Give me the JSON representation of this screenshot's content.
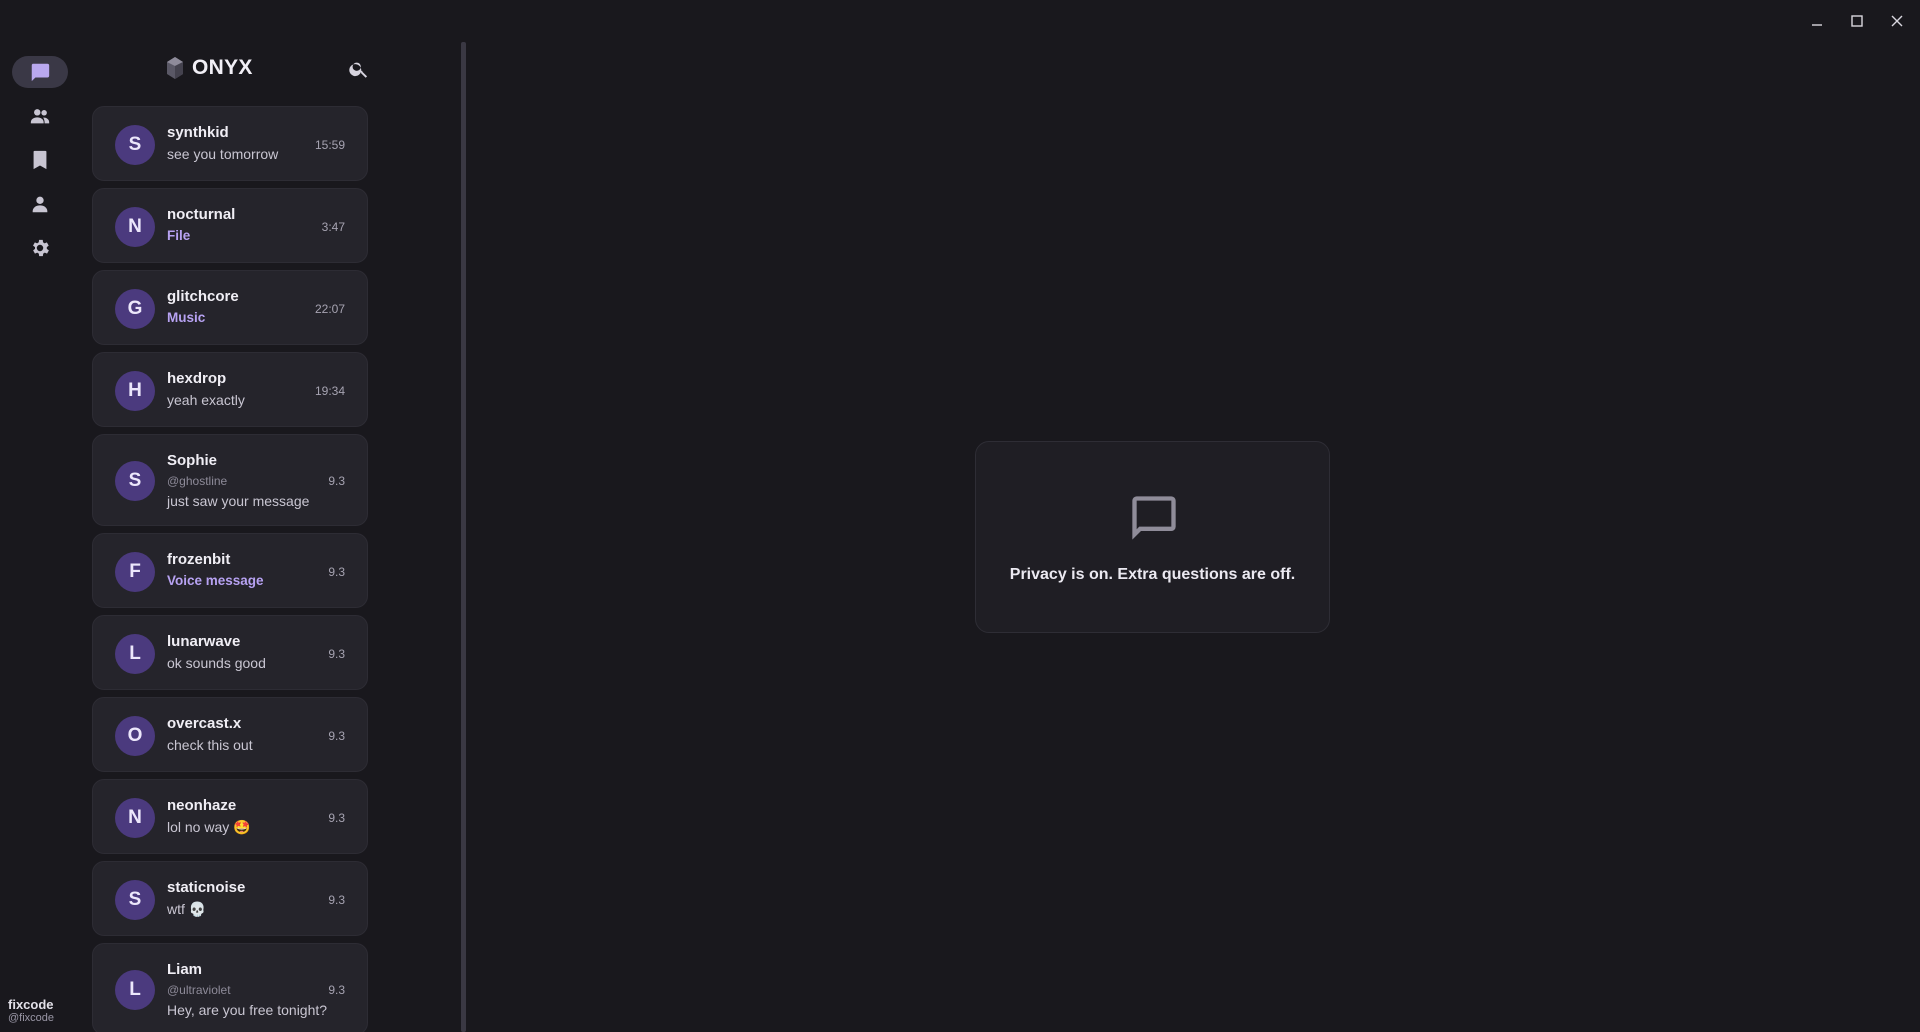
{
  "window": {
    "controls": [
      "minimize-icon",
      "maximize-icon",
      "close-icon"
    ]
  },
  "rail": {
    "items": [
      {
        "name": "chats",
        "icon": "chat-bubble-icon",
        "active": true
      },
      {
        "name": "contacts",
        "icon": "people-icon",
        "active": false
      },
      {
        "name": "saved",
        "icon": "bookmark-icon",
        "active": false
      },
      {
        "name": "profile",
        "icon": "person-icon",
        "active": false
      },
      {
        "name": "settings",
        "icon": "gear-icon",
        "active": false
      }
    ],
    "me": {
      "name": "fixcode",
      "handle": "@fixcode"
    }
  },
  "header": {
    "brand": "ONYX",
    "logo_icon": "crystal-logo-icon",
    "search_icon": "search-icon"
  },
  "conversations": [
    {
      "initial": "S",
      "name": "synthkid",
      "handle": "",
      "preview": "see you tomorrow",
      "media": false,
      "time": "15:59"
    },
    {
      "initial": "N",
      "name": "nocturnal",
      "handle": "",
      "preview": "File",
      "media": true,
      "time": "3:47"
    },
    {
      "initial": "G",
      "name": "glitchcore",
      "handle": "",
      "preview": "Music",
      "media": true,
      "time": "22:07"
    },
    {
      "initial": "H",
      "name": "hexdrop",
      "handle": "",
      "preview": "yeah exactly",
      "media": false,
      "time": "19:34"
    },
    {
      "initial": "S",
      "name": "Sophie",
      "handle": "@ghostline",
      "preview": "just saw your message",
      "media": false,
      "time": "9.3"
    },
    {
      "initial": "F",
      "name": "frozenbit",
      "handle": "",
      "preview": "Voice message",
      "media": true,
      "time": "9.3"
    },
    {
      "initial": "L",
      "name": "lunarwave",
      "handle": "",
      "preview": "ok sounds good",
      "media": false,
      "time": "9.3"
    },
    {
      "initial": "O",
      "name": "overcast.x",
      "handle": "",
      "preview": "check this out",
      "media": false,
      "time": "9.3"
    },
    {
      "initial": "N",
      "name": "neonhaze",
      "handle": "",
      "preview": "lol no way 🤩",
      "media": false,
      "time": "9.3"
    },
    {
      "initial": "S",
      "name": "staticnoise",
      "handle": "",
      "preview": "wtf 💀",
      "media": false,
      "time": "9.3"
    },
    {
      "initial": "L",
      "name": "Liam",
      "handle": "@ultraviolet",
      "preview": "Hey, are you free tonight?",
      "media": false,
      "time": "9.3"
    }
  ],
  "empty_state": {
    "icon": "chat-outline-icon",
    "message": "Privacy is on. Extra questions are off."
  },
  "colors": {
    "background": "#19181d",
    "card": "#25242b",
    "avatar": "#4b3a7e",
    "accent": "#b7a2f2"
  }
}
